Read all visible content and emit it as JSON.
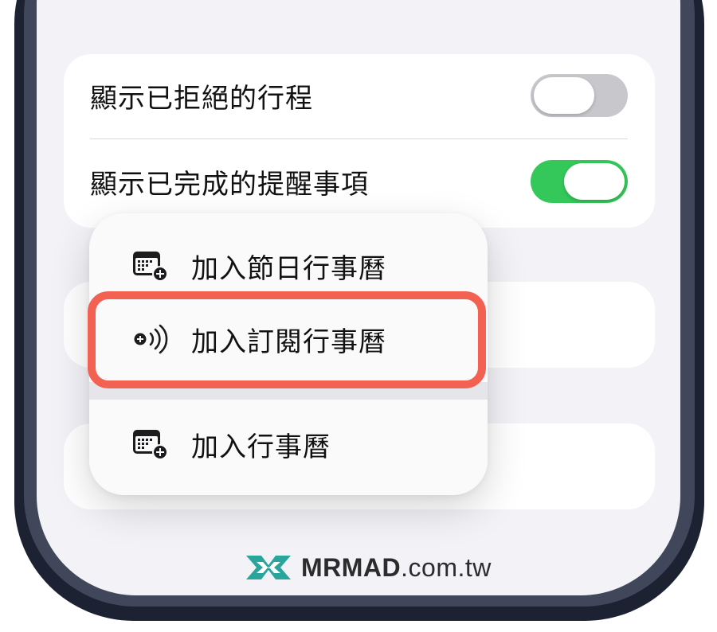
{
  "settings": {
    "rows": [
      {
        "label": "顯示已拒絕的行程",
        "toggle_state": "off"
      },
      {
        "label": "顯示已完成的提醒事項",
        "toggle_state": "on"
      }
    ]
  },
  "menu": {
    "items": [
      {
        "label": "加入節日行事曆",
        "icon": "calendar-add-icon"
      },
      {
        "label": "加入訂閱行事曆",
        "icon": "subscribe-broadcast-icon",
        "highlighted": true
      },
      {
        "label": "加入行事曆",
        "icon": "calendar-add-icon"
      }
    ]
  },
  "watermark": {
    "brand": "MRMAD",
    "domain": ".com.tw"
  },
  "colors": {
    "toggle_on": "#34c759",
    "toggle_off": "#c7c7cc",
    "highlight": "#f26152",
    "logo_teal": "#2aa59b"
  }
}
